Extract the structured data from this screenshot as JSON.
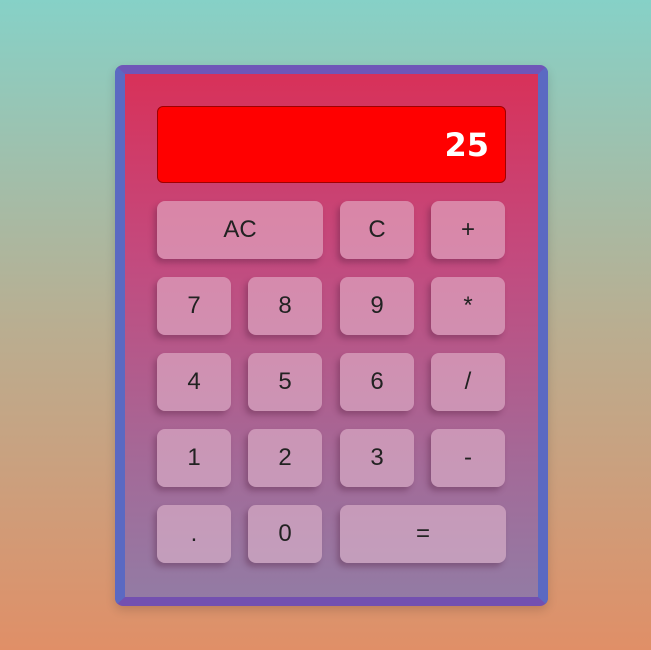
{
  "display": {
    "value": "25"
  },
  "keys": {
    "ac": "AC",
    "c": "C",
    "plus": "+",
    "seven": "7",
    "eight": "8",
    "nine": "9",
    "multiply": "*",
    "four": "4",
    "five": "5",
    "six": "6",
    "divide": "/",
    "one": "1",
    "two": "2",
    "three": "3",
    "minus": "-",
    "dot": ".",
    "zero": "0",
    "equals": "="
  },
  "colors": {
    "display_background": "#ff0000",
    "display_text": "#ffffff",
    "frame": "#5b69c2",
    "body_top": "#d83159",
    "body_bottom": "#937ba4",
    "page_top": "#86d1c7",
    "page_bottom": "#e08f67"
  }
}
